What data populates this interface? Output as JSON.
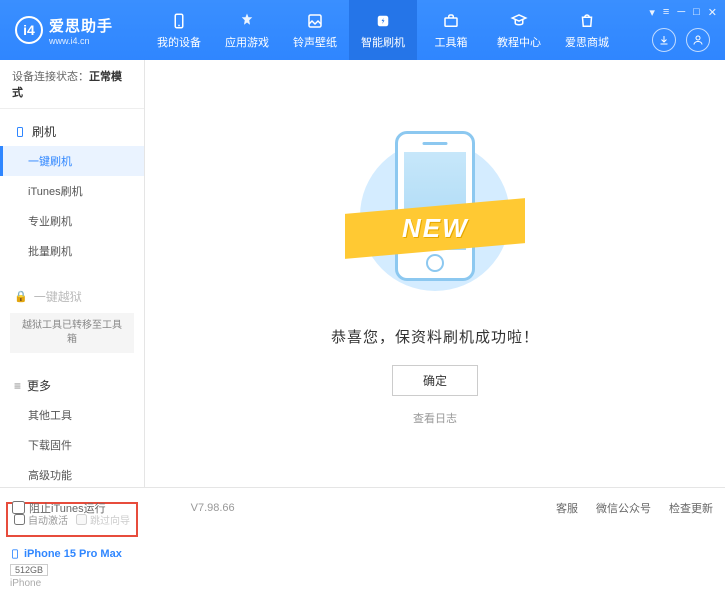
{
  "header": {
    "logo_title": "爱思助手",
    "logo_url": "www.i4.cn",
    "nav": [
      {
        "label": "我的设备"
      },
      {
        "label": "应用游戏"
      },
      {
        "label": "铃声壁纸"
      },
      {
        "label": "智能刷机"
      },
      {
        "label": "工具箱"
      },
      {
        "label": "教程中心"
      },
      {
        "label": "爱思商城"
      }
    ]
  },
  "sidebar": {
    "status_label": "设备连接状态：",
    "status_value": "正常模式",
    "section_flash": "刷机",
    "items_flash": [
      {
        "label": "一键刷机"
      },
      {
        "label": "iTunes刷机"
      },
      {
        "label": "专业刷机"
      },
      {
        "label": "批量刷机"
      }
    ],
    "section_jailbreak": "一键越狱",
    "jailbreak_note": "越狱工具已转移至工具箱",
    "section_more": "更多",
    "items_more": [
      {
        "label": "其他工具"
      },
      {
        "label": "下载固件"
      },
      {
        "label": "高级功能"
      }
    ],
    "auto_activate": "自动激活",
    "skip_guide": "跳过向导",
    "device_name": "iPhone 15 Pro Max",
    "device_storage": "512GB",
    "device_type": "iPhone"
  },
  "main": {
    "ribbon": "NEW",
    "success_text": "恭喜您，保资料刷机成功啦！",
    "confirm": "确定",
    "view_log": "查看日志"
  },
  "footer": {
    "block_itunes": "阻止iTunes运行",
    "version": "V7.98.66",
    "links": [
      "客服",
      "微信公众号",
      "检查更新"
    ]
  }
}
